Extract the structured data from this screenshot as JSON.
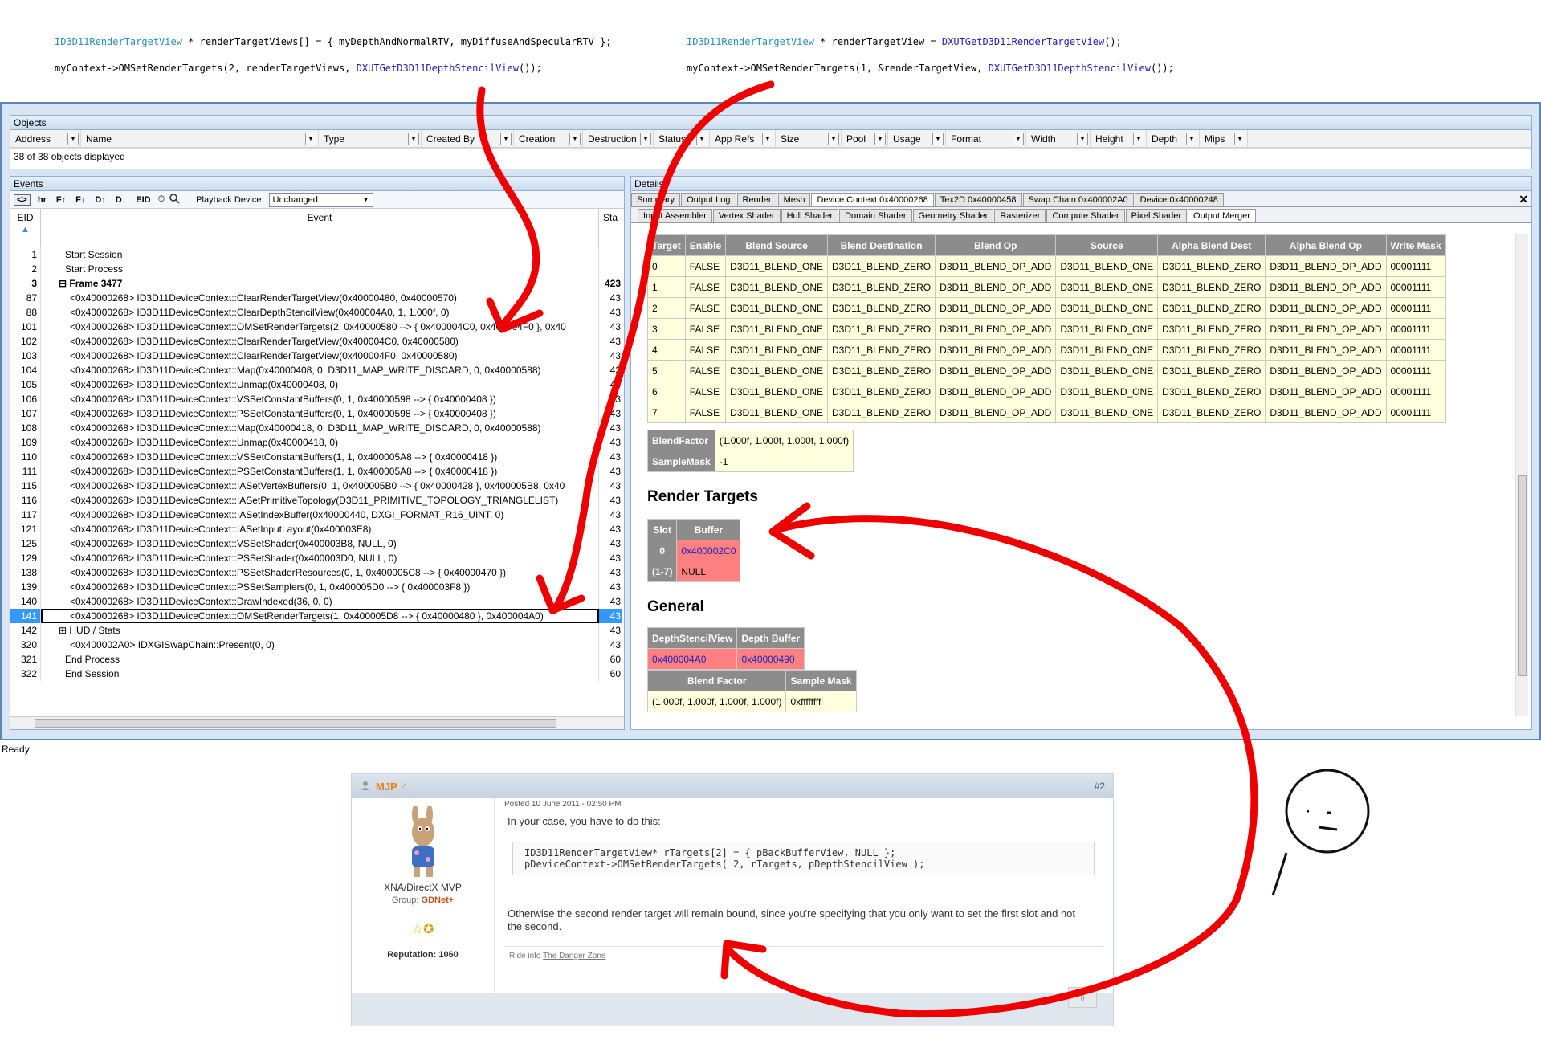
{
  "code_left": {
    "line1_type": "ID3D11RenderTargetView",
    "line1_rest": " * renderTargetViews[] = { myDepthAndNormalRTV, myDiffuseAndSpecularRTV };",
    "line2_pre": "myContext->OMSetRenderTargets(2, renderTargetViews, ",
    "line2_fn": "DXUTGetD3D11DepthStencilView",
    "line2_post": "());"
  },
  "code_right": {
    "line1_type": "ID3D11RenderTargetView",
    "line1_mid": " * renderTargetView = ",
    "line1_fn": "DXUTGetD3D11RenderTargetView",
    "line1_post": "();",
    "line2_pre": "myContext->OMSetRenderTargets(1, &renderTargetView, ",
    "line2_fn": "DXUTGetD3D11DepthStencilView",
    "line2_post": "());"
  },
  "objects": {
    "title": "Objects",
    "columns": [
      "Address",
      "Name",
      "Type",
      "Created By",
      "Creation",
      "Destruction",
      "Status",
      "App Refs",
      "Size",
      "Pool",
      "Usage",
      "Format",
      "Width",
      "Height",
      "Depth",
      "Mips"
    ],
    "status": "38 of 38 objects displayed"
  },
  "events": {
    "title": "Events",
    "toolbar": [
      "<>",
      "hr",
      "F↑",
      "F↓",
      "D↑",
      "D↓",
      "EID"
    ],
    "playback_label": "Playback Device:",
    "playback_value": "Unchanged",
    "col_eid": "EID",
    "col_event": "Event",
    "col_sta": "Sta",
    "rows": [
      {
        "eid": "1",
        "text": "Start Session",
        "sta": ""
      },
      {
        "eid": "2",
        "text": "Start Process",
        "sta": ""
      },
      {
        "eid": "3",
        "text": "⊟ Frame 3477",
        "sta": "423"
      },
      {
        "eid": "87",
        "text": "<0x40000268> ID3D11DeviceContext::ClearRenderTargetView(0x40000480, 0x40000570)",
        "sta": "43"
      },
      {
        "eid": "88",
        "text": "<0x40000268> ID3D11DeviceContext::ClearDepthStencilView(0x400004A0, 1, 1.000f, 0)",
        "sta": "43"
      },
      {
        "eid": "101",
        "text": "<0x40000268> ID3D11DeviceContext::OMSetRenderTargets(2, 0x40000580 --> { 0x400004C0, 0x400004F0 }, 0x40",
        "sta": "43"
      },
      {
        "eid": "102",
        "text": "<0x40000268> ID3D11DeviceContext::ClearRenderTargetView(0x400004C0, 0x40000580)",
        "sta": "43"
      },
      {
        "eid": "103",
        "text": "<0x40000268> ID3D11DeviceContext::ClearRenderTargetView(0x400004F0, 0x40000580)",
        "sta": "43"
      },
      {
        "eid": "104",
        "text": "<0x40000268> ID3D11DeviceContext::Map(0x40000408, 0, D3D11_MAP_WRITE_DISCARD, 0, 0x40000588)",
        "sta": "43"
      },
      {
        "eid": "105",
        "text": "<0x40000268> ID3D11DeviceContext::Unmap(0x40000408, 0)",
        "sta": "43"
      },
      {
        "eid": "106",
        "text": "<0x40000268> ID3D11DeviceContext::VSSetConstantBuffers(0, 1, 0x40000598 --> { 0x40000408 })",
        "sta": "43"
      },
      {
        "eid": "107",
        "text": "<0x40000268> ID3D11DeviceContext::PSSetConstantBuffers(0, 1, 0x40000598 --> { 0x40000408 })",
        "sta": "43"
      },
      {
        "eid": "108",
        "text": "<0x40000268> ID3D11DeviceContext::Map(0x40000418, 0, D3D11_MAP_WRITE_DISCARD, 0, 0x40000588)",
        "sta": "43"
      },
      {
        "eid": "109",
        "text": "<0x40000268> ID3D11DeviceContext::Unmap(0x40000418, 0)",
        "sta": "43"
      },
      {
        "eid": "110",
        "text": "<0x40000268> ID3D11DeviceContext::VSSetConstantBuffers(1, 1, 0x400005A8 --> { 0x40000418 })",
        "sta": "43"
      },
      {
        "eid": "111",
        "text": "<0x40000268> ID3D11DeviceContext::PSSetConstantBuffers(1, 1, 0x400005A8 --> { 0x40000418 })",
        "sta": "43"
      },
      {
        "eid": "115",
        "text": "<0x40000268> ID3D11DeviceContext::IASetVertexBuffers(0, 1, 0x400005B0 --> { 0x40000428 }, 0x400005B8, 0x40",
        "sta": "43"
      },
      {
        "eid": "116",
        "text": "<0x40000268> ID3D11DeviceContext::IASetPrimitiveTopology(D3D11_PRIMITIVE_TOPOLOGY_TRIANGLELIST)",
        "sta": "43"
      },
      {
        "eid": "117",
        "text": "<0x40000268> ID3D11DeviceContext::IASetIndexBuffer(0x40000440, DXGI_FORMAT_R16_UINT, 0)",
        "sta": "43"
      },
      {
        "eid": "121",
        "text": "<0x40000268> ID3D11DeviceContext::IASetInputLayout(0x400003E8)",
        "sta": "43"
      },
      {
        "eid": "125",
        "text": "<0x40000268> ID3D11DeviceContext::VSSetShader(0x400003B8, NULL, 0)",
        "sta": "43"
      },
      {
        "eid": "129",
        "text": "<0x40000268> ID3D11DeviceContext::PSSetShader(0x400003D0, NULL, 0)",
        "sta": "43"
      },
      {
        "eid": "138",
        "text": "<0x40000268> ID3D11DeviceContext::PSSetShaderResources(0, 1, 0x400005C8 --> { 0x40000470 })",
        "sta": "43"
      },
      {
        "eid": "139",
        "text": "<0x40000268> ID3D11DeviceContext::PSSetSamplers(0, 1, 0x400005D0 --> { 0x400003F8 })",
        "sta": "43"
      },
      {
        "eid": "140",
        "text": "<0x40000268> ID3D11DeviceContext::DrawIndexed(36, 0, 0)",
        "sta": "43"
      },
      {
        "eid": "141",
        "text": "<0x40000268> ID3D11DeviceContext::OMSetRenderTargets(1, 0x400005D8 --> { 0x40000480 }, 0x400004A0)",
        "sta": "43"
      },
      {
        "eid": "142",
        "text": "⊞ HUD / Stats",
        "sta": "43"
      },
      {
        "eid": "320",
        "text": "<0x400002A0> IDXGISwapChain::Present(0, 0)",
        "sta": "43"
      },
      {
        "eid": "321",
        "text": "End Process",
        "sta": "60"
      },
      {
        "eid": "322",
        "text": "End Session",
        "sta": "60"
      }
    ],
    "selected_eid": "141"
  },
  "details": {
    "title": "Details",
    "tabs_top": [
      "Summary",
      "Output Log",
      "Render",
      "Mesh",
      "Device Context 0x40000268",
      "Tex2D 0x40000458",
      "Swap Chain 0x400002A0",
      "Device 0x40000248"
    ],
    "active_top": "Device Context 0x40000268",
    "tabs_sub": [
      "Input Assembler",
      "Vertex Shader",
      "Hull Shader",
      "Domain Shader",
      "Geometry Shader",
      "Rasterizer",
      "Compute Shader",
      "Pixel Shader",
      "Output Merger"
    ],
    "active_sub": "Output Merger",
    "blend_headers": [
      "Target",
      "Enable",
      "Blend Source",
      "Blend Destination",
      "Blend Op",
      "Source",
      "Alpha Blend Dest",
      "Alpha Blend Op",
      "Write Mask"
    ],
    "blend_rows": [
      [
        "0",
        "FALSE",
        "D3D11_BLEND_ONE",
        "D3D11_BLEND_ZERO",
        "D3D11_BLEND_OP_ADD",
        "D3D11_BLEND_ONE",
        "D3D11_BLEND_ZERO",
        "D3D11_BLEND_OP_ADD",
        "00001111"
      ],
      [
        "1",
        "FALSE",
        "D3D11_BLEND_ONE",
        "D3D11_BLEND_ZERO",
        "D3D11_BLEND_OP_ADD",
        "D3D11_BLEND_ONE",
        "D3D11_BLEND_ZERO",
        "D3D11_BLEND_OP_ADD",
        "00001111"
      ],
      [
        "2",
        "FALSE",
        "D3D11_BLEND_ONE",
        "D3D11_BLEND_ZERO",
        "D3D11_BLEND_OP_ADD",
        "D3D11_BLEND_ONE",
        "D3D11_BLEND_ZERO",
        "D3D11_BLEND_OP_ADD",
        "00001111"
      ],
      [
        "3",
        "FALSE",
        "D3D11_BLEND_ONE",
        "D3D11_BLEND_ZERO",
        "D3D11_BLEND_OP_ADD",
        "D3D11_BLEND_ONE",
        "D3D11_BLEND_ZERO",
        "D3D11_BLEND_OP_ADD",
        "00001111"
      ],
      [
        "4",
        "FALSE",
        "D3D11_BLEND_ONE",
        "D3D11_BLEND_ZERO",
        "D3D11_BLEND_OP_ADD",
        "D3D11_BLEND_ONE",
        "D3D11_BLEND_ZERO",
        "D3D11_BLEND_OP_ADD",
        "00001111"
      ],
      [
        "5",
        "FALSE",
        "D3D11_BLEND_ONE",
        "D3D11_BLEND_ZERO",
        "D3D11_BLEND_OP_ADD",
        "D3D11_BLEND_ONE",
        "D3D11_BLEND_ZERO",
        "D3D11_BLEND_OP_ADD",
        "00001111"
      ],
      [
        "6",
        "FALSE",
        "D3D11_BLEND_ONE",
        "D3D11_BLEND_ZERO",
        "D3D11_BLEND_OP_ADD",
        "D3D11_BLEND_ONE",
        "D3D11_BLEND_ZERO",
        "D3D11_BLEND_OP_ADD",
        "00001111"
      ],
      [
        "7",
        "FALSE",
        "D3D11_BLEND_ONE",
        "D3D11_BLEND_ZERO",
        "D3D11_BLEND_OP_ADD",
        "D3D11_BLEND_ONE",
        "D3D11_BLEND_ZERO",
        "D3D11_BLEND_OP_ADD",
        "00001111"
      ]
    ],
    "blend_factor_label": "BlendFactor",
    "blend_factor_value": "(1.000f, 1.000f, 1.000f, 1.000f)",
    "sample_mask_label": "SampleMask",
    "sample_mask_value": "-1",
    "rt_heading": "Render Targets",
    "rt_headers": [
      "Slot",
      "Buffer"
    ],
    "rt_rows": [
      [
        "0",
        "0x400002C0"
      ],
      [
        "(1-7)",
        "NULL"
      ]
    ],
    "general_heading": "General",
    "gen_headers": [
      "DepthStencilView",
      "Depth Buffer"
    ],
    "gen_values": [
      "0x400004A0",
      "0x40000490"
    ],
    "gen2_headers": [
      "Blend Factor",
      "Sample Mask"
    ],
    "gen2_values": [
      "(1.000f, 1.000f, 1.000f, 1.000f)",
      "0xffffffff"
    ]
  },
  "status": "Ready",
  "post": {
    "author": "MJP",
    "number": "#2",
    "posted": "Posted 10 June 2011 - 02:50 PM",
    "title_user": "XNA/DirectX MVP",
    "group_label": "Group:",
    "group_value": "GDNet+",
    "reputation": "Reputation: 1060",
    "intro": "In your case, you have to do this:",
    "code_line1": "ID3D11RenderTargetView* rTargets[2] = { pBackBufferView, NULL };",
    "code_line2": "pDeviceContext->OMSetRenderTargets( 2, rTargets, pDepthStencilView );",
    "body": "Otherwise the second render target will remain bound, since you're specifying that you only want to set the first slot and not the second.",
    "signature_pre": "Ride info ",
    "signature_link": "The Danger Zone",
    "vote": "0"
  },
  "colors": {
    "arrow": "#ee0000",
    "selection": "#3399ff",
    "highlight": "#ff8080",
    "link": "#2020e0"
  }
}
